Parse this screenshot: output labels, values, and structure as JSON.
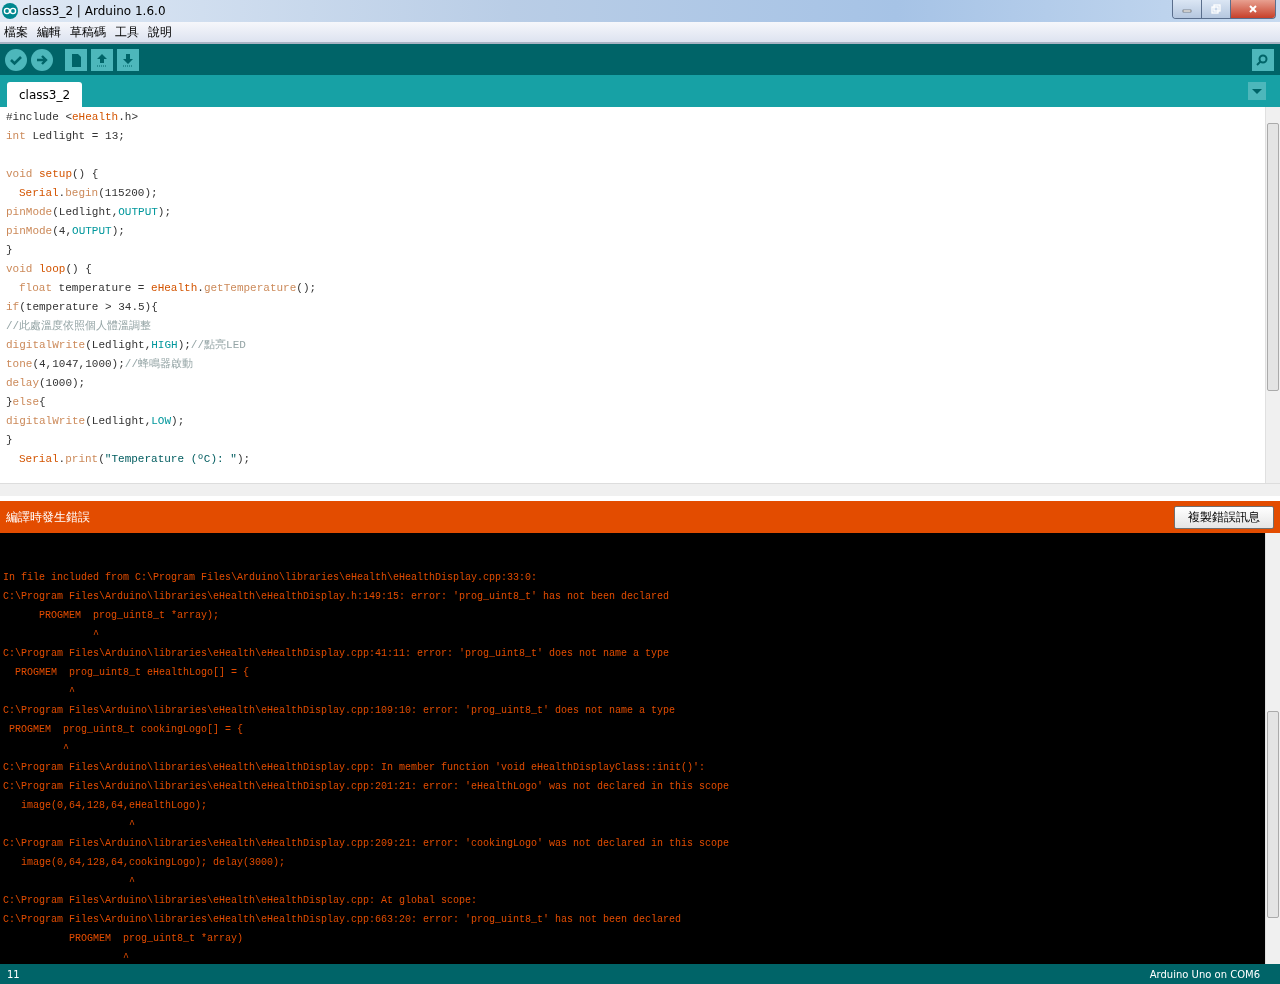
{
  "window": {
    "title": "class3_2 | Arduino 1.6.0"
  },
  "menu": [
    "檔案",
    "編輯",
    "草稿碼",
    "工具",
    "說明"
  ],
  "toolbar": [
    {
      "kind": "verify"
    },
    {
      "kind": "upload"
    },
    {
      "kind": "new"
    },
    {
      "kind": "open"
    },
    {
      "kind": "save"
    }
  ],
  "tabs": [
    {
      "label": "class3_2",
      "selected": true
    }
  ],
  "code": [
    {
      "tokens": [
        {
          "kind": "plain",
          "text": "#include <"
        },
        {
          "kind": "name",
          "text": "eHealth"
        },
        {
          "kind": "plain",
          "text": ".h>"
        }
      ]
    },
    {
      "tokens": [
        {
          "kind": "keyword",
          "text": "int"
        },
        {
          "kind": "plain",
          "text": " Ledlight = 13;"
        }
      ]
    },
    {
      "blank_before": true,
      "tokens": [
        {
          "kind": "keyword",
          "text": "void"
        },
        {
          "kind": "name",
          "text": " setup"
        },
        {
          "kind": "plain",
          "text": "() {"
        }
      ]
    },
    {
      "indent": true,
      "tokens": [
        {
          "kind": "name",
          "text": "Serial"
        },
        {
          "kind": "plain",
          "text": "."
        },
        {
          "kind": "method",
          "text": "begin"
        },
        {
          "kind": "plain",
          "text": "(115200);"
        }
      ]
    },
    {
      "tokens": [
        {
          "kind": "method",
          "text": "pinMode"
        },
        {
          "kind": "plain",
          "text": "(Ledlight,"
        },
        {
          "kind": "constant",
          "text": "OUTPUT"
        },
        {
          "kind": "plain",
          "text": ");"
        }
      ]
    },
    {
      "tokens": [
        {
          "kind": "method",
          "text": "pinMode"
        },
        {
          "kind": "plain",
          "text": "(4,"
        },
        {
          "kind": "constant",
          "text": "OUTPUT"
        },
        {
          "kind": "plain",
          "text": ");"
        }
      ]
    },
    {
      "tokens": [
        {
          "kind": "plain",
          "text": "}"
        }
      ]
    },
    {
      "tokens": [
        {
          "kind": "keyword",
          "text": "void"
        },
        {
          "kind": "name",
          "text": " loop"
        },
        {
          "kind": "plain",
          "text": "() {"
        }
      ]
    },
    {
      "indent": true,
      "tokens": [
        {
          "kind": "keyword",
          "text": "float"
        },
        {
          "kind": "plain",
          "text": " temperature = "
        },
        {
          "kind": "name",
          "text": "eHealth"
        },
        {
          "kind": "plain",
          "text": "."
        },
        {
          "kind": "method",
          "text": "getTemperature"
        },
        {
          "kind": "plain",
          "text": "();"
        }
      ]
    },
    {
      "tokens": [
        {
          "kind": "keyword",
          "text": "if"
        },
        {
          "kind": "plain",
          "text": "(temperature > 34.5){"
        }
      ]
    },
    {
      "tokens": [
        {
          "kind": "comment",
          "text": "//此處溫度依照個人體溫調整"
        }
      ]
    },
    {
      "tokens": [
        {
          "kind": "method",
          "text": "digitalWrite"
        },
        {
          "kind": "plain",
          "text": "(Ledlight,"
        },
        {
          "kind": "constant",
          "text": "HIGH"
        },
        {
          "kind": "plain",
          "text": ");"
        },
        {
          "kind": "comment",
          "text": "//點亮LED"
        }
      ]
    },
    {
      "tokens": [
        {
          "kind": "method",
          "text": "tone"
        },
        {
          "kind": "plain",
          "text": "(4,1047,1000);"
        },
        {
          "kind": "comment",
          "text": "//蜂鳴器啟動"
        }
      ]
    },
    {
      "tokens": [
        {
          "kind": "method",
          "text": "delay"
        },
        {
          "kind": "plain",
          "text": "(1000);"
        }
      ]
    },
    {
      "tokens": [
        {
          "kind": "plain",
          "text": "}"
        },
        {
          "kind": "keyword",
          "text": "else"
        },
        {
          "kind": "plain",
          "text": "{"
        }
      ]
    },
    {
      "tokens": [
        {
          "kind": "method",
          "text": "digitalWrite"
        },
        {
          "kind": "plain",
          "text": "(Ledlight,"
        },
        {
          "kind": "constant",
          "text": "LOW"
        },
        {
          "kind": "plain",
          "text": ");"
        }
      ]
    },
    {
      "tokens": [
        {
          "kind": "plain",
          "text": "}"
        }
      ]
    },
    {
      "indent": true,
      "tokens": [
        {
          "kind": "name",
          "text": "Serial"
        },
        {
          "kind": "plain",
          "text": "."
        },
        {
          "kind": "method",
          "text": "print"
        },
        {
          "kind": "plain",
          "text": "("
        },
        {
          "kind": "string",
          "text": "\"Temperature (ºC): \""
        },
        {
          "kind": "plain",
          "text": ");"
        }
      ]
    }
  ],
  "error_bar": {
    "message": "編譯時發生錯誤",
    "button": "複製錯誤訊息"
  },
  "console": [
    "In file included from C:\\Program Files\\Arduino\\libraries\\eHealth\\eHealthDisplay.cpp:33:0:",
    "C:\\Program Files\\Arduino\\libraries\\eHealth\\eHealthDisplay.h:149:15: error: 'prog_uint8_t' has not been declared",
    "      PROGMEM  prog_uint8_t *array);",
    "               ^",
    "C:\\Program Files\\Arduino\\libraries\\eHealth\\eHealthDisplay.cpp:41:11: error: 'prog_uint8_t' does not name a type",
    "  PROGMEM  prog_uint8_t eHealthLogo[] = {",
    "           ^",
    "C:\\Program Files\\Arduino\\libraries\\eHealth\\eHealthDisplay.cpp:109:10: error: 'prog_uint8_t' does not name a type",
    " PROGMEM  prog_uint8_t cookingLogo[] = {",
    "          ^",
    "C:\\Program Files\\Arduino\\libraries\\eHealth\\eHealthDisplay.cpp: In member function 'void eHealthDisplayClass::init()':",
    "C:\\Program Files\\Arduino\\libraries\\eHealth\\eHealthDisplay.cpp:201:21: error: 'eHealthLogo' was not declared in this scope",
    "   image(0,64,128,64,eHealthLogo);",
    "                     ^",
    "C:\\Program Files\\Arduino\\libraries\\eHealth\\eHealthDisplay.cpp:209:21: error: 'cookingLogo' was not declared in this scope",
    "   image(0,64,128,64,cookingLogo); delay(3000);",
    "                     ^",
    "C:\\Program Files\\Arduino\\libraries\\eHealth\\eHealthDisplay.cpp: At global scope:",
    "C:\\Program Files\\Arduino\\libraries\\eHealth\\eHealthDisplay.cpp:663:20: error: 'prog_uint8_t' has not been declared",
    "           PROGMEM  prog_uint8_t *array)",
    "                    ^"
  ],
  "status_bar": {
    "line": "11",
    "board": "Arduino Uno on COM6"
  }
}
